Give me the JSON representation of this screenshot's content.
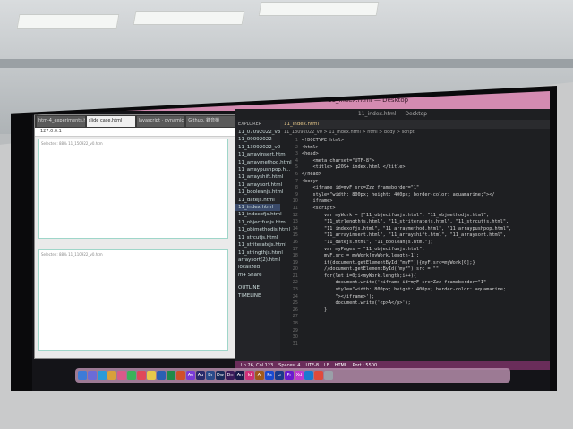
{
  "menubar": {
    "title": "11_index.html — Desktop"
  },
  "browser": {
    "tabs": [
      "htm-4_experiments.htm",
      "slide case.html",
      "Javascript · dynamically add i...",
      "Github, 錄音機"
    ],
    "address": "127.0.0.1",
    "frame_top_label": "Selected: 88%  11_150922_v0.htm",
    "frame_bottom_label": "Selected: 88%  11_110922_v0.htm",
    "footer_tabs": [
      "11_090922_v0.zip",
      "11_070922_v1.zip"
    ]
  },
  "vscode": {
    "explorer_header": "EXPLORER",
    "files": [
      "11_07092022_v3",
      "11_09092022",
      "11_13092022_v0",
      "11_arrayinsert.html",
      "11_arraymethod.html",
      "11_arraypushpop.h...",
      "11_arrayshift.html",
      "11_arraysort.html",
      "11_booleanjs.html",
      "11_datejs.html",
      "11_index.html",
      "11_indexofjs.html",
      "11_objectfunjs.html",
      "11_objmethodjs.html",
      "11_strcutjs.html",
      "11_striteratejs.html",
      "11_stringthjs.html",
      "arraysort(2).html",
      "localized",
      "m4 Share"
    ],
    "selected_file": "11_index.html",
    "outline": [
      "OUTLINE",
      "TIMELINE"
    ],
    "tab_label": "11_index.html",
    "breadcrumb": "11_13092022_v0 > 11_index.html > html > body > script",
    "line_numbers": [
      "1",
      "2",
      "3",
      "4",
      "5",
      "6",
      "7",
      "8",
      "9",
      "10",
      "11",
      "12",
      "13",
      "14",
      "15",
      "16",
      "17",
      "18",
      "19",
      "20",
      "21",
      "22",
      "23",
      "24",
      "25",
      "26",
      "27",
      "28",
      "29",
      "30",
      "31"
    ],
    "code_lines": [
      "<!DOCTYPE html>",
      "<html>",
      "<head>",
      "    <meta charset=\"UTF-8\">",
      "    <title> p209+ index.html </title>",
      "</head>",
      "",
      "<body>",
      "",
      "    <iframe id=myF src=Zzz frameborder=\"1\"",
      "    style=\"width: 800px; height: 400px; border-color: aquamarine;\"></",
      "    iframe>",
      "",
      "    <script>",
      "        var myWork = [\"11_objectfunjs.html\", \"11_objmethodjs.html\",",
      "        \"11_strlengthjs.html\", \"11_striteratejs.html\", \"11_strcutjs.html\",",
      "        \"11_indexofjs.html\", \"11_arraymethod.html\", \"11_arraypushpop.html\",",
      "        \"11_arrayinsert.html\", \"11_arrayshift.html\", \"11_arraysort.html\",",
      "        \"11_datejs.html\", \"11_booleanjs.html\"];",
      "",
      "        var myPages = \"11_objectfunjs.html\";",
      "        myF.src = myWork[myWork.length-1];",
      "        if(document.getElementById(\"myF\")){myF.src=myWork[0];}",
      "        //document.getElementById(\"myF\").src = \"\";",
      "",
      "        for(let i=0;i<myWork.length;i++){",
      "            document.write('<iframe id=myF src=Zzz frameborder=\"1\"",
      "            style=\"width: 800px; height: 400px; border-color: aquamarine;",
      "            \"></iframe>');",
      "            document.write('<p>A</p>');",
      "        }"
    ],
    "status": [
      "Ln 26, Col 123",
      "Spaces: 4",
      "UTF-8",
      "LF",
      "HTML",
      "Port : 5500"
    ]
  },
  "dock": [
    "Finder",
    "Launchpad",
    "Safari",
    "Mail",
    "Photos",
    "FaceTime",
    "Music",
    "Notes",
    "Word",
    "Excel",
    "PowerPoint",
    "Ae",
    "Au",
    "Br",
    "Dw",
    "Dn",
    "An",
    "Id",
    "Ai",
    "Ps",
    "Lr",
    "Pr",
    "Xd",
    "Code",
    "Chrome",
    "Trash"
  ],
  "colors": {
    "menubar": "#d48bb1",
    "status": "#6a2d5a",
    "editor": "#1e1f22",
    "accent": "#9fd6c9"
  }
}
